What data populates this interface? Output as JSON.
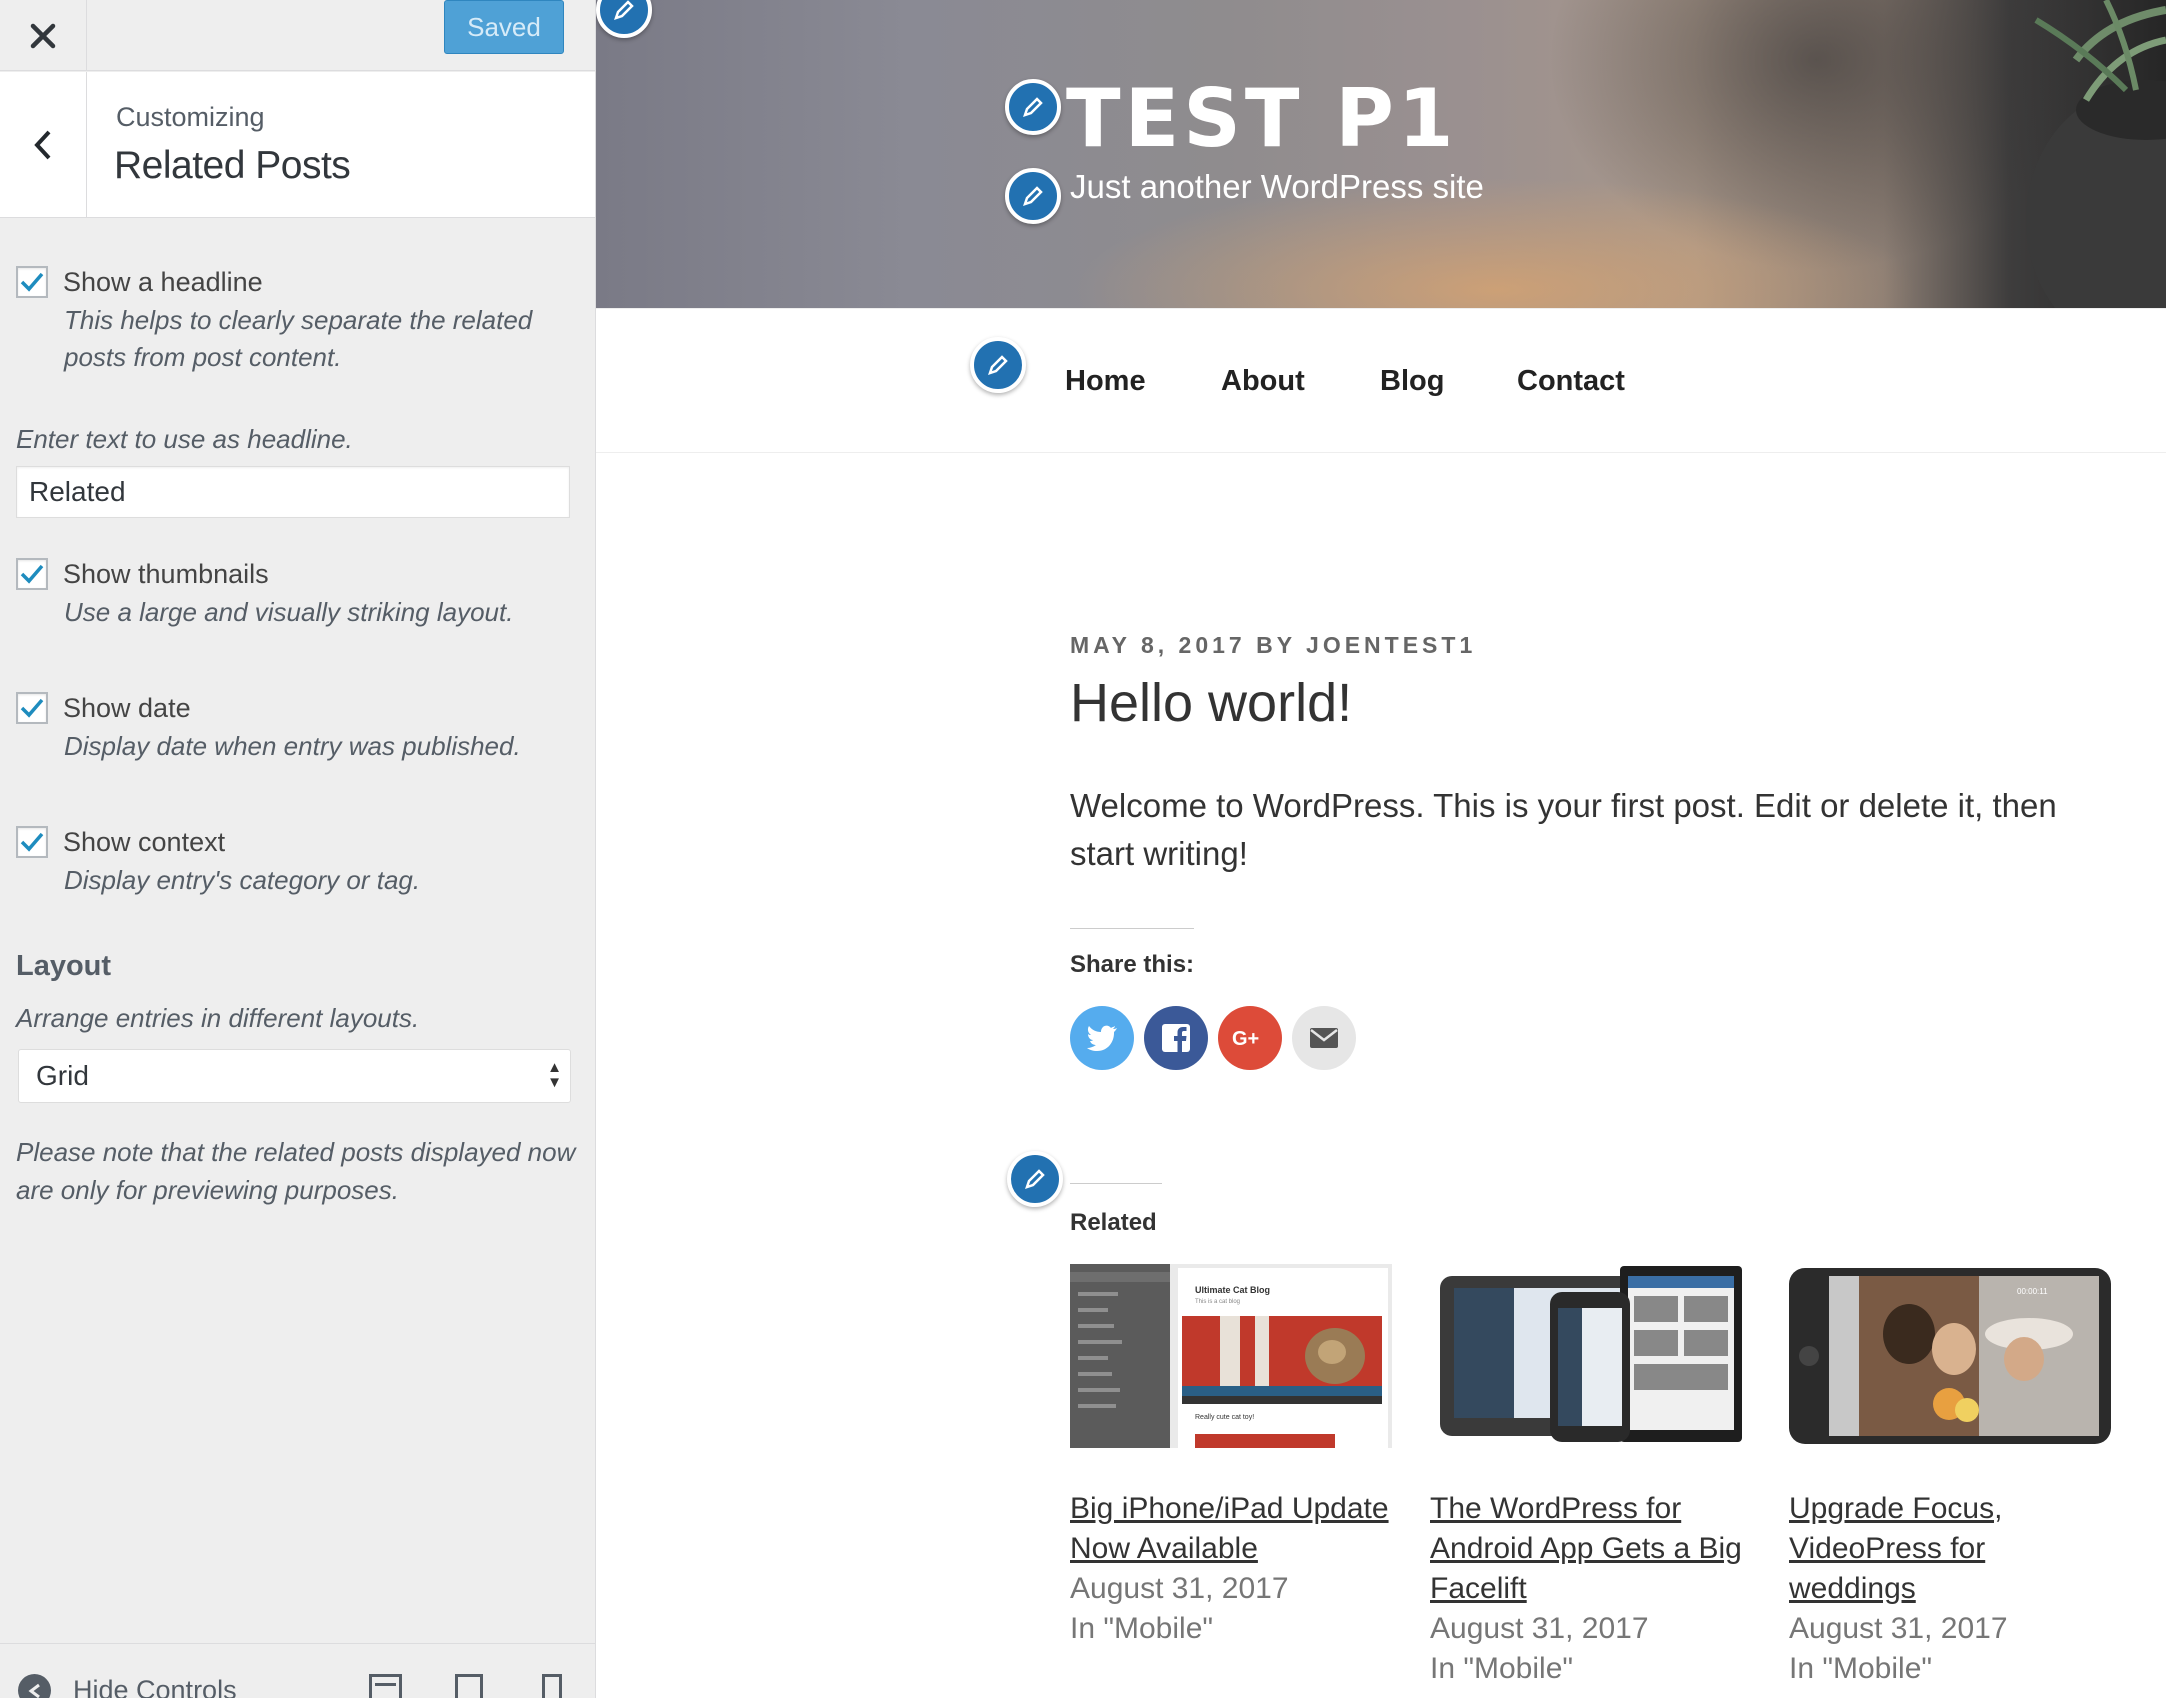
{
  "sidebar": {
    "save_label": "Saved",
    "section_crumb": "Customizing",
    "section_title": "Related Posts",
    "show_headline": {
      "label": "Show a headline",
      "description": "This helps to clearly separate the related posts from post content.",
      "checked": true
    },
    "headline_prompt": "Enter text to use as headline.",
    "headline_value": "Related",
    "show_thumbnails": {
      "label": "Show thumbnails",
      "description": "Use a large and visually striking layout.",
      "checked": true
    },
    "show_date": {
      "label": "Show date",
      "description": "Display date when entry was published.",
      "checked": true
    },
    "show_context": {
      "label": "Show context",
      "description": "Display entry's category or tag.",
      "checked": true
    },
    "layout_title": "Layout",
    "layout_description": "Arrange entries in different layouts.",
    "layout_value": "Grid",
    "note": "Please note that the related posts displayed now are only for previewing purposes.",
    "hide_controls_label": "Hide Controls",
    "accent_color": "#4fa1d6"
  },
  "preview": {
    "site_title": "TEST P1",
    "tagline": "Just another WordPress site",
    "nav": [
      "Home",
      "About",
      "Blog",
      "Contact"
    ],
    "post": {
      "meta": "MAY 8, 2017 BY JOENTEST1",
      "title": "Hello world!",
      "body": "Welcome to WordPress. This is your first post. Edit or delete it, then start writing!",
      "share_title": "Share this:",
      "share_buttons": [
        "twitter-icon",
        "facebook-icon",
        "google-plus-icon",
        "email-icon"
      ]
    },
    "related_title": "Related",
    "related": [
      {
        "title": "Big iPhone/iPad Update Now Available",
        "date": "August 31, 2017",
        "context": "In \"Mobile\""
      },
      {
        "title": "The WordPress for Android App Gets a Big Facelift",
        "date": "August 31, 2017",
        "context": "In \"Mobile\""
      },
      {
        "title": "Upgrade Focus, VideoPress for weddings",
        "date": "August 31, 2017",
        "context": "In \"Mobile\""
      }
    ],
    "thumb1": {
      "blog_name": "Ultimate Cat Blog",
      "tagline": "This is a cat blog",
      "post_caption": "Really cute cat toy!",
      "menu_items": [
        "Ultimate Cat Blog",
        "Posts",
        "Pages",
        "Comments",
        "Stats",
        "View Site",
        "Dashboard"
      ]
    },
    "thumb3": {
      "timer": "00:00:11"
    }
  }
}
